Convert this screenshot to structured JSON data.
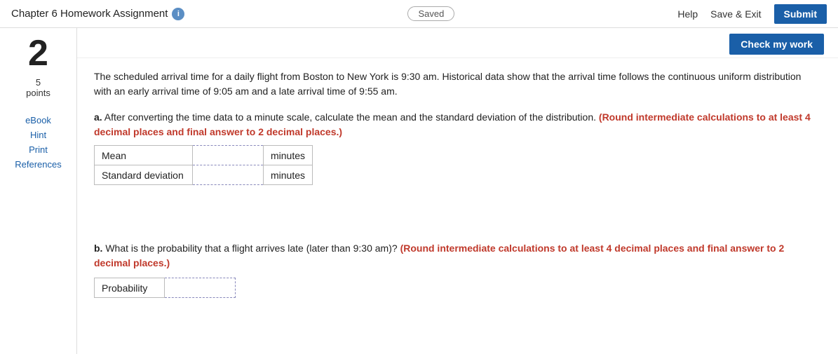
{
  "header": {
    "title": "Chapter 6 Homework Assignment",
    "info_icon_label": "i",
    "saved_label": "Saved",
    "help_label": "Help",
    "save_exit_label": "Save & Exit",
    "submit_label": "Submit"
  },
  "check_my_work_btn": "Check my work",
  "question": {
    "number": "2",
    "points": "5",
    "points_label": "points"
  },
  "sidebar": {
    "ebook_label": "eBook",
    "hint_label": "Hint",
    "print_label": "Print",
    "references_label": "References"
  },
  "content": {
    "intro_text": "The scheduled arrival time for a daily flight from Boston to New York is 9:30 am. Historical data show that the arrival time follows the continuous uniform distribution with an early arrival time of 9:05 am and a late arrival time of 9:55 am.",
    "part_a": {
      "label": "a.",
      "text": " After converting the time data to a minute scale, calculate the mean and the standard deviation of the distribution.",
      "red_text": "(Round intermediate calculations to at least 4 decimal places and final answer to 2 decimal places.)"
    },
    "table_rows": [
      {
        "label": "Mean",
        "unit": "minutes"
      },
      {
        "label": "Standard deviation",
        "unit": "minutes"
      }
    ],
    "part_b": {
      "label": "b.",
      "text": " What is the probability that a flight arrives late (later than 9:30 am)?",
      "red_text": "(Round intermediate calculations to at least 4 decimal places and final answer to 2 decimal places.)",
      "prob_label": "Probability"
    }
  }
}
